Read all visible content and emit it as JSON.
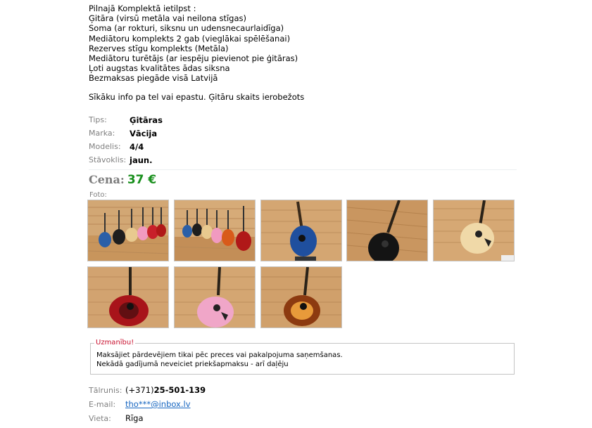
{
  "description": {
    "lines": [
      "Pilnajā Komplektā ietilpst :",
      "Ģitāra (virsū metāla vai neilona stīgas)",
      "Soma (ar rokturi, siksnu un udensnecaurlaidīga)",
      "Mediātoru komplekts 2 gab (vieglākai spēlēšanai)",
      "Rezerves stīgu komplekts (Metāla)",
      "Mediātoru turētājs (ar iespēju pievienot pie ģitāras)",
      "Ļoti augstas kvalitātes ādas siksna",
      "Bezmaksas piegāde visā Latvijā"
    ],
    "info": "Sīkāku info pa tel vai epastu. Ģitāru skaits ierobežots"
  },
  "specs": [
    {
      "label": "Tips:",
      "value": "Ģitāras"
    },
    {
      "label": "Marka:",
      "value": "Vācija"
    },
    {
      "label": "Modelis:",
      "value": "4/4"
    },
    {
      "label": "Stāvoklis:",
      "value": "jaun."
    }
  ],
  "price": {
    "label": "Cena:",
    "value": "37 €",
    "color": "#188f1c"
  },
  "photos": {
    "label": "Foto:",
    "items": [
      {
        "icon": "guitar-group-photo"
      },
      {
        "icon": "guitar-group-photo"
      },
      {
        "icon": "blue-guitar-photo"
      },
      {
        "icon": "black-guitar-photo"
      },
      {
        "icon": "natural-guitar-photo"
      },
      {
        "icon": "red-guitar-photo"
      },
      {
        "icon": "pink-guitar-photo"
      },
      {
        "icon": "sunburst-guitar-photo"
      }
    ]
  },
  "warning": {
    "title": "Uzmanību!",
    "line1": "Maksājiet pārdevējiem tikai pēc preces vai pakalpojuma saņemšanas.",
    "line2": "Nekādā gadījumā neveiciet priekšapmaksu - arī daļēju",
    "color": "#c8102e"
  },
  "contacts": {
    "phone_label": "Tālrunis:",
    "phone_prefix": "(+371)",
    "phone_number": "25-501-139",
    "email_label": "E-mail:",
    "email": "tho***@inbox.lv",
    "location_label": "Vieta:",
    "location": "Rīga"
  }
}
